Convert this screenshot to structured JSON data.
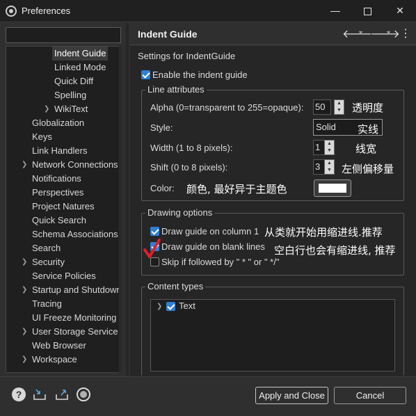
{
  "window": {
    "title": "Preferences",
    "minimize": "—",
    "close": "✕"
  },
  "sidebar": {
    "filter_placeholder": "",
    "items": [
      {
        "label": "Indent Guide",
        "level": 2,
        "selected": true
      },
      {
        "label": "Linked Mode",
        "level": 2
      },
      {
        "label": "Quick Diff",
        "level": 2
      },
      {
        "label": "Spelling",
        "level": 2
      },
      {
        "label": "WikiText",
        "level": 2,
        "expandable": true
      },
      {
        "label": "Globalization",
        "level": 1
      },
      {
        "label": "Keys",
        "level": 1
      },
      {
        "label": "Link Handlers",
        "level": 1
      },
      {
        "label": "Network Connections",
        "level": 1,
        "expandable": true
      },
      {
        "label": "Notifications",
        "level": 1
      },
      {
        "label": "Perspectives",
        "level": 1
      },
      {
        "label": "Project Natures",
        "level": 1
      },
      {
        "label": "Quick Search",
        "level": 1
      },
      {
        "label": "Schema Associations",
        "level": 1
      },
      {
        "label": "Search",
        "level": 1
      },
      {
        "label": "Security",
        "level": 1,
        "expandable": true
      },
      {
        "label": "Service Policies",
        "level": 1
      },
      {
        "label": "Startup and Shutdown",
        "level": 1,
        "expandable": true
      },
      {
        "label": "Tracing",
        "level": 1
      },
      {
        "label": "UI Freeze Monitoring",
        "level": 1
      },
      {
        "label": "User Storage Service",
        "level": 1,
        "expandable": true
      },
      {
        "label": "Web Browser",
        "level": 1
      },
      {
        "label": "Workspace",
        "level": 1,
        "expandable": true
      }
    ]
  },
  "page": {
    "title": "Indent Guide",
    "subtitle": "Settings for IndentGuide",
    "enable_label": "Enable the indent guide",
    "line_attributes": {
      "title": "Line attributes",
      "alpha_label": "Alpha (0=transparent to 255=opaque):",
      "alpha_value": "50",
      "alpha_note": "透明度",
      "style_label": "Style:",
      "style_value": "Solid",
      "style_note": "实线",
      "width_label": "Width (1 to 8 pixels):",
      "width_value": "1",
      "width_note": "线宽",
      "shift_label": "Shift (0 to 8 pixels):",
      "shift_value": "3",
      "shift_note": "左侧偏移量",
      "color_label": "Color:",
      "color_note": "颜色, 最好异于主题色",
      "color_value": "#ffffff"
    },
    "drawing_options": {
      "title": "Drawing options",
      "col1_label": "Draw guide on column 1",
      "col1_note": "从类就开始用缩进线.推荐",
      "blank_label": "Draw guide on blank lines",
      "blank_note": "空白行也会有缩进线, 推荐",
      "skip_label": "Skip if followed by \" * \" or \" */\""
    },
    "content_types": {
      "title": "Content types",
      "items": [
        {
          "label": "Text",
          "checked": true
        }
      ]
    }
  },
  "footer": {
    "apply_close": "Apply and Close",
    "cancel": "Cancel"
  },
  "colors": {
    "accent": "#2f7fd6",
    "annotation_mark": "#e0202a"
  }
}
